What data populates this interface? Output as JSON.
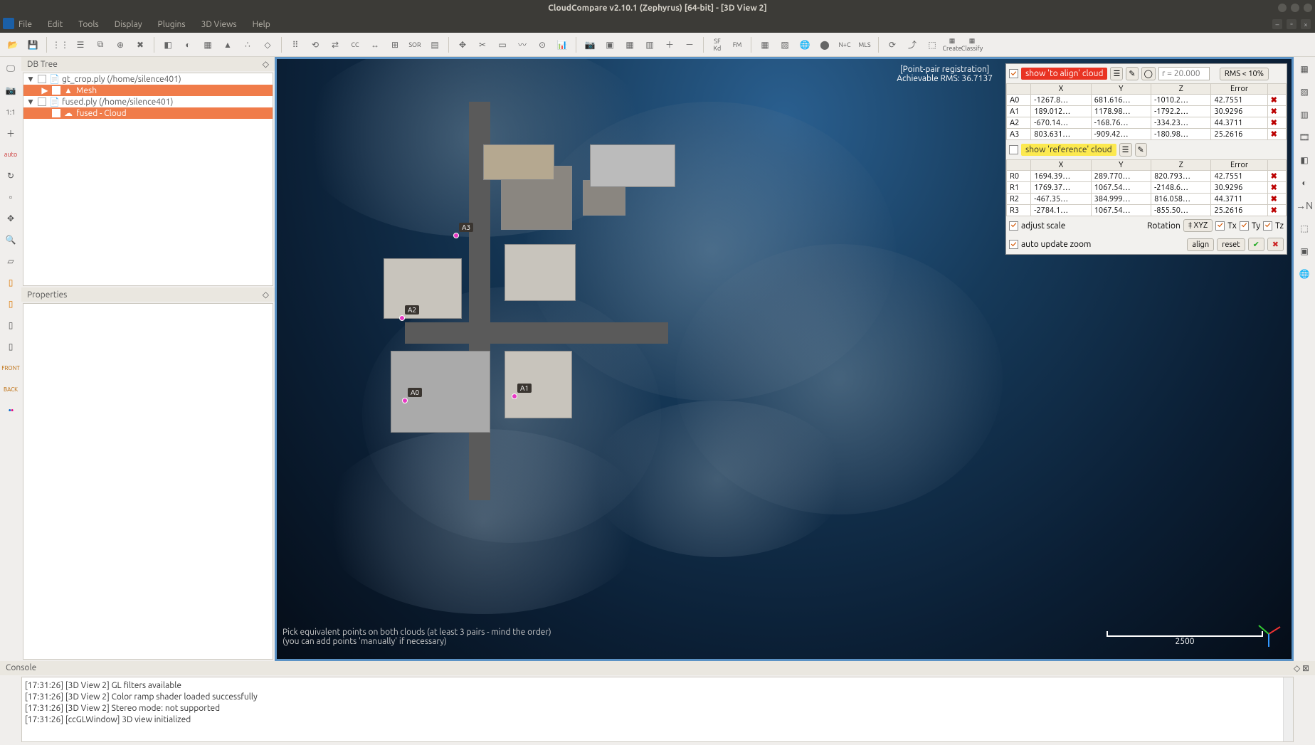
{
  "window": {
    "title": "CloudCompare v2.10.1 (Zephyrus) [64-bit] - [3D View 2]"
  },
  "menu": {
    "items": [
      "File",
      "Edit",
      "Tools",
      "Display",
      "Plugins",
      "3D Views",
      "Help"
    ]
  },
  "panels": {
    "dbtree": "DB Tree",
    "properties": "Properties",
    "console": "Console"
  },
  "tree": {
    "n0": "gt_crop.ply (/home/silence401)",
    "n0a": "Mesh",
    "n1": "fused.ply (/home/silence401)",
    "n1a": "fused - Cloud"
  },
  "viewport": {
    "mode": "[Point-pair registration]",
    "rms": "Achievable RMS: 36.7137",
    "hint1": "Pick equivalent points on both clouds (at least 3 pairs - mind the order)",
    "hint2": "(you can add points 'manually' if necessary)",
    "scale": "2500",
    "markers": {
      "a0": "A0",
      "a1": "A1",
      "a2": "A2",
      "a3": "A3"
    }
  },
  "align_panel": {
    "show_align": "show 'to align' cloud",
    "show_ref": "show 'reference' cloud",
    "r_placeholder": "r = 20.000",
    "rms_btn": "RMS < 10%",
    "headers": {
      "x": "X",
      "y": "Y",
      "z": "Z",
      "err": "Error"
    },
    "align_rows": [
      {
        "id": "A0",
        "x": "-1267.8…",
        "y": "681.616…",
        "z": "-1010.2…",
        "err": "42.7551"
      },
      {
        "id": "A1",
        "x": "189.012…",
        "y": "1178.98…",
        "z": "-1792.2…",
        "err": "30.9296"
      },
      {
        "id": "A2",
        "x": "-670.14…",
        "y": "-168.76…",
        "z": "-334.23…",
        "err": "44.3711"
      },
      {
        "id": "A3",
        "x": "803.631…",
        "y": "-909.42…",
        "z": "-180.98…",
        "err": "25.2616"
      }
    ],
    "ref_rows": [
      {
        "id": "R0",
        "x": "1694.39…",
        "y": "289.770…",
        "z": "820.793…",
        "err": "42.7551"
      },
      {
        "id": "R1",
        "x": "1769.37…",
        "y": "1067.54…",
        "z": "-2148.6…",
        "err": "30.9296"
      },
      {
        "id": "R2",
        "x": "-467.35…",
        "y": "384.999…",
        "z": "816.058…",
        "err": "44.3711"
      },
      {
        "id": "R3",
        "x": "-2784.1…",
        "y": "1067.54…",
        "z": "-855.50…",
        "err": "25.2616"
      }
    ],
    "adjust_scale": "adjust scale",
    "rotation": "Rotation",
    "xyz": "‡ XYZ",
    "tx": "Tx",
    "ty": "Ty",
    "tz": "Tz",
    "auto_zoom": "auto update zoom",
    "align_btn": "align",
    "reset_btn": "reset"
  },
  "console": {
    "lines": [
      "[17:31:26] [3D View 2] GL filters available",
      "[17:31:26] [3D View 2] Color ramp shader loaded successfully",
      "[17:31:26] [3D View 2] Stereo mode: not supported",
      "[17:31:26] [ccGLWindow] 3D view initialized"
    ]
  }
}
